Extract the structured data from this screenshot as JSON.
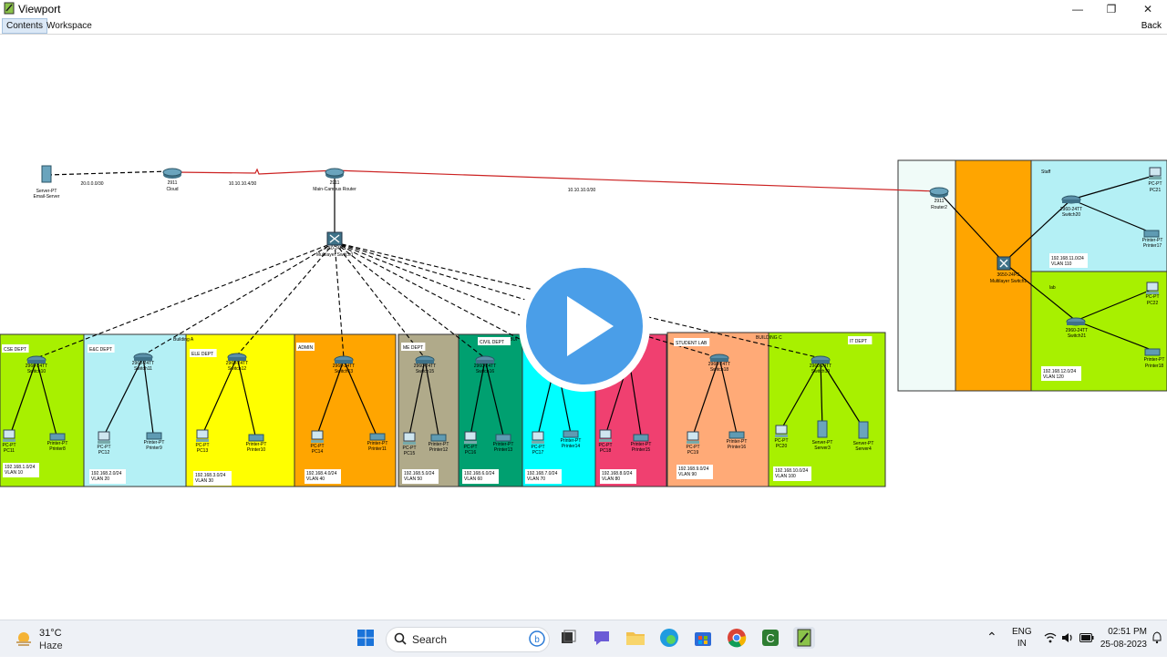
{
  "window": {
    "title": "Viewport",
    "minimize": "—",
    "maximize": "❐",
    "close": "✕"
  },
  "menu": {
    "contents": "Contents",
    "workspace": "Workspace",
    "back": "Back"
  },
  "devices": {
    "server_email": [
      "Server-PT",
      "Email-Server"
    ],
    "cloud": [
      "2911",
      "Cloud"
    ],
    "main_router": [
      "2911",
      "Main-Campus Router"
    ],
    "multilayer": [
      "3650-24PS",
      "Multilayer Switch0"
    ],
    "router2": [
      "2911",
      "Router2"
    ],
    "multilayer_right": [
      "3650-24PS",
      "Multilayer Switch1"
    ]
  },
  "links": {
    "l1": "20.0.0.0/30",
    "l2": "10.10.10.4/30",
    "l3": "10.10.10.0/30"
  },
  "departments": [
    {
      "name": "CSE DEPT",
      "switch": [
        "2960-24TT",
        "Switch10"
      ],
      "pc": [
        "PC-PT",
        "PC11"
      ],
      "printer": [
        "Printer-PT",
        "Printer8"
      ],
      "net": "192.168.1.0/24",
      "vlan": "VLAN 10"
    },
    {
      "name": "E&C DEPT",
      "switch": [
        "2960-24TT",
        "Switch11"
      ],
      "pc": [
        "PC-PT",
        "PC12"
      ],
      "printer": [
        "Printer-PT",
        "Printer9"
      ],
      "net": "192.168.2.0/24",
      "vlan": "VLAN 20"
    },
    {
      "name": "ELE DEPT",
      "switch": [
        "2960-24TT",
        "Switch12"
      ],
      "pc": [
        "PC-PT",
        "PC13"
      ],
      "printer": [
        "Printer-PT",
        "Printer10"
      ],
      "net": "192.168.3.0/24",
      "vlan": "VLAN 30"
    },
    {
      "name": "ADMIN",
      "switch": [
        "2960-24TT",
        "Switch13"
      ],
      "pc": [
        "PC-PT",
        "PC14"
      ],
      "printer": [
        "Printer-PT",
        "Printer11"
      ],
      "net": "192.168.4.0/24",
      "vlan": "VLAN 40"
    },
    {
      "name": "ME DEPT",
      "switch": [
        "2960-24TT",
        "Switch15"
      ],
      "pc": [
        "PC-PT",
        "PC15"
      ],
      "printer": [
        "Printer-PT",
        "Printer12"
      ],
      "net": "192.168.5.0/24",
      "vlan": "VLAN 50"
    },
    {
      "name": "CIVIL DEPT",
      "switch": [
        "2960-24TT",
        "Switch16"
      ],
      "pc": [
        "PC-PT",
        "PC16"
      ],
      "printer": [
        "Printer-PT",
        "Printer13"
      ],
      "net": "192.168.6.0/24",
      "vlan": "VLAN 60"
    },
    {
      "name": "",
      "switch": [
        "",
        ""
      ],
      "pc": [
        "PC-PT",
        "PC17"
      ],
      "printer": [
        "Printer-PT",
        "Printer14"
      ],
      "net": "192.168.7.0/24",
      "vlan": "VLAN 70"
    },
    {
      "name": "",
      "switch": [
        "",
        ""
      ],
      "pc": [
        "PC-PT",
        "PC18"
      ],
      "printer": [
        "Printer-PT",
        "Printer15"
      ],
      "net": "192.168.8.0/24",
      "vlan": "VLAN 80"
    },
    {
      "name": "STUDENT LAB",
      "switch": [
        "2960-24TT",
        "Switch18"
      ],
      "pc": [
        "PC-PT",
        "PC19"
      ],
      "printer": [
        "Printer-PT",
        "Printer16"
      ],
      "net": "192.168.9.0/24",
      "vlan": "VLAN 90"
    },
    {
      "name": "IT DEPT",
      "switch": [
        "2960-24TT",
        "Switch19"
      ],
      "pc": [
        "PC-PT",
        "PC20"
      ],
      "printer": [
        "Server-PT",
        "Server3"
      ],
      "server2": [
        "Server-PT",
        "Server4"
      ],
      "net": "192.168.10.0/24",
      "vlan": "VLAN 100"
    }
  ],
  "buildings": {
    "a": "Building A",
    "b": "BUI",
    "c": "BUILDING C"
  },
  "right": {
    "staff": {
      "name": "Staff",
      "switch": [
        "2960-24TT",
        "Switch20"
      ],
      "pc": [
        "PC-PT",
        "PC21"
      ],
      "printer": [
        "Printer-PT",
        "Printer17"
      ],
      "net": "192.168.11.0/24",
      "vlan": "VLAN 110"
    },
    "lab": {
      "name": "lab",
      "switch": [
        "2960-24TT",
        "Switch21"
      ],
      "pc": [
        "PC-PT",
        "PC22"
      ],
      "printer": [
        "Printer-PT",
        "Printer18"
      ],
      "net": "192.168.12.0/24",
      "vlan": "VLAN 120"
    }
  },
  "taskbar": {
    "temp": "31°C",
    "condition": "Haze",
    "search": "Search",
    "lang1": "ENG",
    "lang2": "IN",
    "time": "02:51 PM",
    "date": "25-08-2023"
  },
  "colors": {
    "cse": "#a8f000",
    "ec": "#b4f0f5",
    "ele": "#ffff00",
    "admin": "#ffa500",
    "me": "#b0aa8a",
    "civil": "#00a070",
    "cyan": "#00ffff",
    "pink": "#f04070",
    "student": "#ffaa77",
    "it": "#a8f000",
    "router_box": "#f0fbf8",
    "play": "#4a9ee8",
    "serial_link": "#cc2222"
  }
}
